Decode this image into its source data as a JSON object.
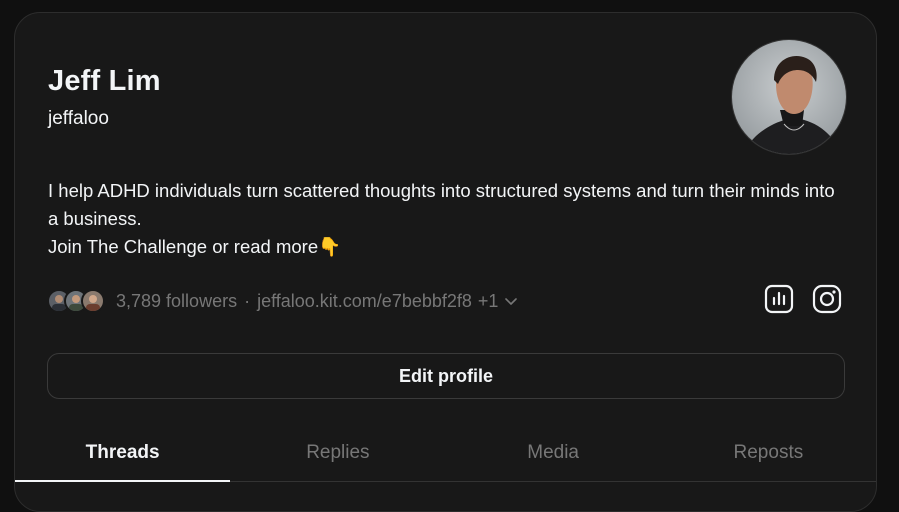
{
  "profile": {
    "name": "Jeff Lim",
    "handle": "jeffaloo",
    "bio_line1": "I help ADHD individuals turn scattered thoughts into structured systems and turn their minds into a business.",
    "bio_line2": "Join The Challenge or read more👇"
  },
  "meta": {
    "followers": "3,789 followers",
    "separator": "·",
    "link": "jeffaloo.kit.com/e7bebbf2f8",
    "more_links": "+1"
  },
  "actions": {
    "edit_profile": "Edit profile"
  },
  "tabs": [
    {
      "label": "Threads",
      "active": true
    },
    {
      "label": "Replies",
      "active": false
    },
    {
      "label": "Media",
      "active": false
    },
    {
      "label": "Reposts",
      "active": false
    }
  ],
  "icons": {
    "insights": "bar-chart-icon",
    "instagram": "instagram-icon",
    "chevron": "chevron-down-icon"
  },
  "colors": {
    "background": "#101010",
    "card": "#181818",
    "text": "#f3f5f7",
    "muted": "#777777",
    "border": "#333333"
  }
}
